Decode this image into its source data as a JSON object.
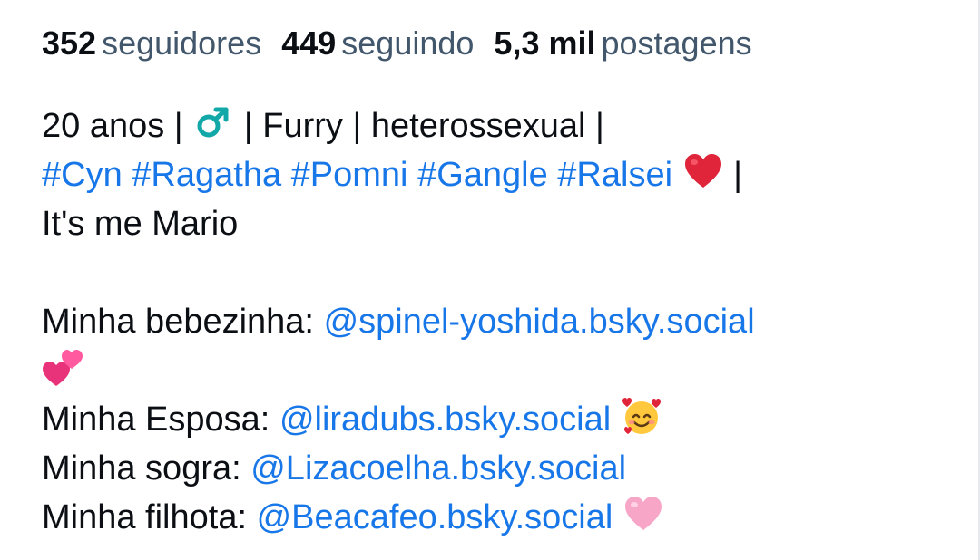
{
  "stats": [
    {
      "value": "352",
      "label": "seguidores"
    },
    {
      "value": "449",
      "label": "seguindo"
    },
    {
      "value": "5,3 mil",
      "label": "postagens"
    }
  ],
  "bio": {
    "line1": {
      "age": "20 anos",
      "sep": "|",
      "gender_icon": "male-sign-icon",
      "furry": "Furry",
      "orientation": "heterossexual"
    },
    "hashtags": [
      "#Cyn",
      "#Ragatha",
      "#Pomni",
      "#Gangle",
      "#Ralsei"
    ],
    "heart_icon": "red-heart-icon",
    "line3": "It's me Mario",
    "relations": [
      {
        "label": "Minha bebezinha:",
        "handle": "@spinel-yoshida.bsky.social",
        "emoji": "two-hearts-icon"
      },
      {
        "label": "Minha Esposa:",
        "handle": "@liradubs.bsky.social",
        "emoji": "smiling-face-with-hearts-icon"
      },
      {
        "label": "Minha sogra:",
        "handle": "@Lizacoelha.bsky.social",
        "emoji": ""
      },
      {
        "label": "Minha filhota:",
        "handle": "@Beacafeo.bsky.social",
        "emoji": "pink-heart-icon"
      }
    ]
  },
  "colors": {
    "link": "#1877e8",
    "muted": "#42576c",
    "text": "#0b0f14",
    "male_sign": "#13a8a8",
    "red_heart": "#e0243a",
    "pink_heart": "#f7a6c8",
    "two_hearts": "#e8327a"
  }
}
